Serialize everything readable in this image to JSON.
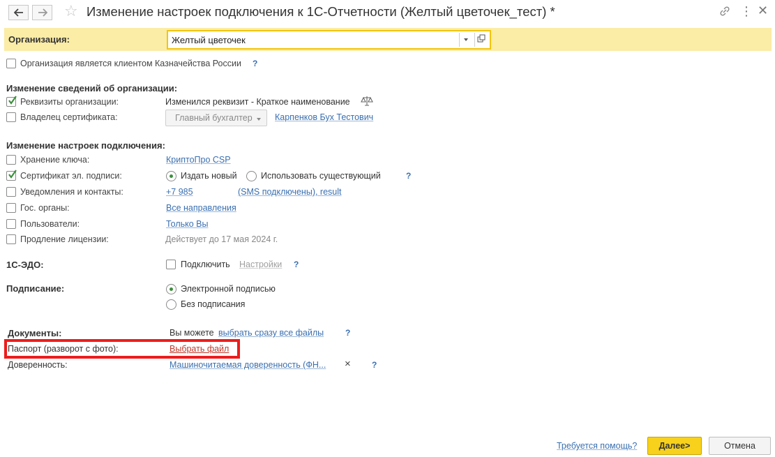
{
  "window": {
    "title": "Изменение настроек подключения к 1С-Отчетности (Желтый цветочек_тест) *"
  },
  "organization": {
    "label": "Организация:",
    "value": "Желтый цветочек"
  },
  "treasury_client": {
    "label": "Организация является клиентом Казначейства России",
    "help": "?"
  },
  "org_changes": {
    "title": "Изменение сведений об организации:",
    "details_label": "Реквизиты организации:",
    "details_value": "Изменился реквизит - Краткое наименование",
    "owner_label": "Владелец сертификата:",
    "owner_role": "Главный бухгалтер",
    "owner_name": "Карпенков Бух Тестович"
  },
  "connection_settings": {
    "title": "Изменение настроек подключения:",
    "key_storage_label": "Хранение ключа:",
    "key_storage_value": "КриптоПро CSP",
    "certificate_label": "Сертификат эл. подписи:",
    "certificate_option_new": "Издать новый",
    "certificate_option_existing": "Использовать существующий",
    "help": "?",
    "notifications_label": "Уведомления и контакты:",
    "notifications_phone": "+7 985",
    "notifications_status": "(SMS подключены), result",
    "gov_label": "Гос. органы:",
    "gov_value": "Все направления",
    "users_label": "Пользователи:",
    "users_value": "Только Вы",
    "license_label": "Продление лицензии:",
    "license_value": "Действует до 17 мая 2024 г."
  },
  "edo": {
    "label": "1С-ЭДО:",
    "connect_label": "Подключить",
    "settings_label": "Настройки",
    "help": "?"
  },
  "signing": {
    "label": "Подписание:",
    "option_electronic": "Электронной подписью",
    "option_none": "Без подписания"
  },
  "documents": {
    "label": "Документы:",
    "hint_prefix": "Вы можете",
    "hint_link": "выбрать сразу все файлы",
    "help": "?",
    "passport_label": "Паспорт (разворот с фото):",
    "passport_action": "Выбрать файл",
    "proxy_label": "Доверенность:",
    "proxy_value": "Машиночитаемая доверенность (ФН...",
    "proxy_remove": "×",
    "proxy_help": "?"
  },
  "footer": {
    "help_link": "Требуется помощь?",
    "next_label": "Далее>",
    "cancel_label": "Отмена"
  },
  "colors": {
    "accent_yellow": "#f7d11b",
    "org_band": "#fbeca6",
    "link_blue": "#3a6fb0",
    "highlight_red": "#ee1c1c"
  }
}
